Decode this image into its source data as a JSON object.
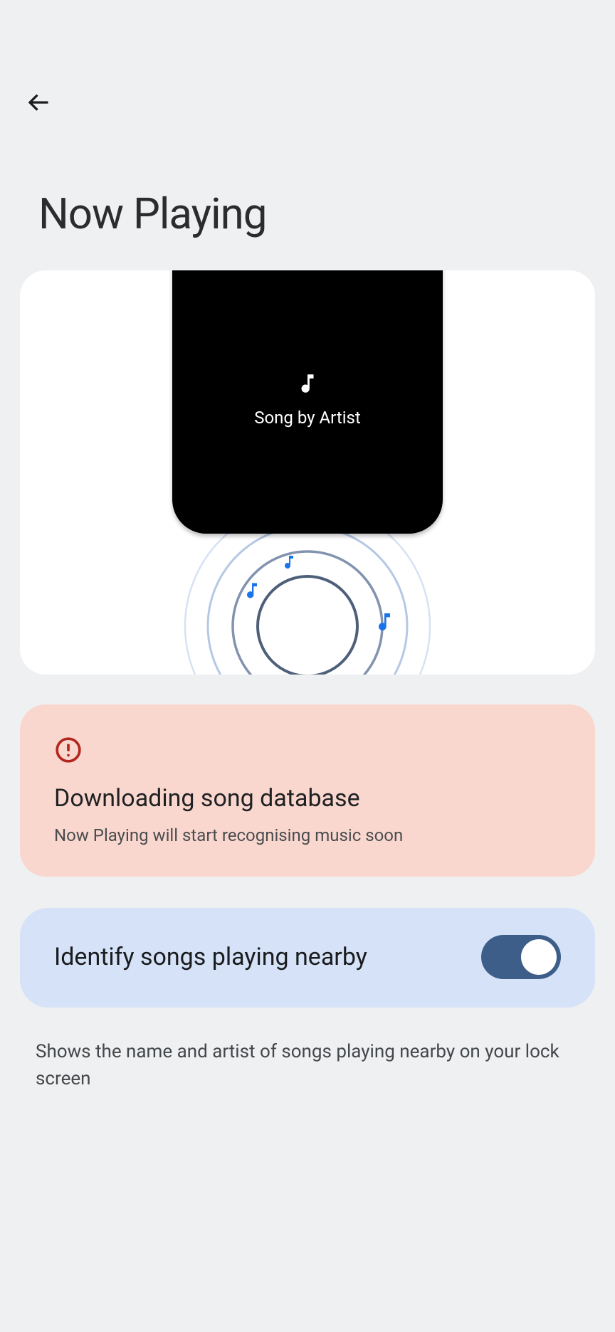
{
  "page": {
    "title": "Now Playing"
  },
  "hero": {
    "caption": "Song by Artist"
  },
  "alert": {
    "title": "Downloading song database",
    "subtitle": "Now Playing will start recognising music soon"
  },
  "toggle": {
    "label": "Identify songs playing nearby",
    "on": true
  },
  "description": "Shows the name and artist of songs playing nearby on your lock screen"
}
